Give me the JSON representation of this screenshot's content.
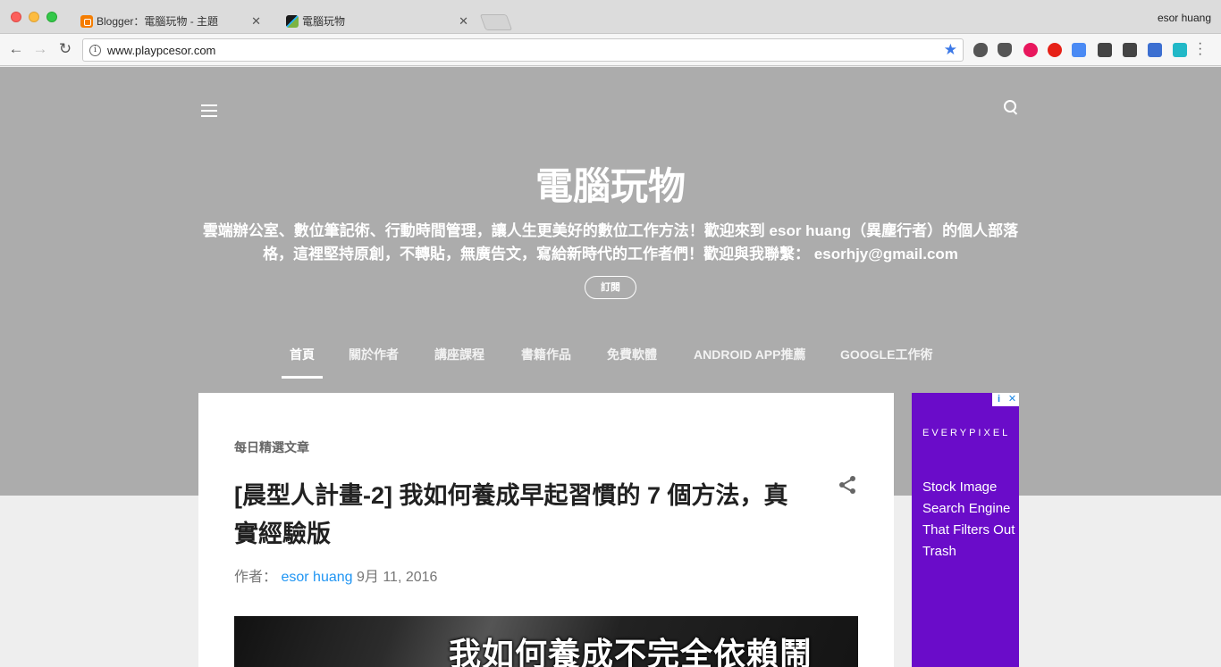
{
  "browser": {
    "tabs": [
      {
        "title": "Blogger：電腦玩物 - 主題",
        "close": "✕"
      },
      {
        "title": "電腦玩物",
        "close": "✕"
      }
    ],
    "profile": "esor huang",
    "url": "www.playpcesor.com",
    "info_glyph": "i",
    "star_glyph": "★",
    "back_glyph": "←",
    "forward_glyph": "→",
    "reload_glyph": "↻"
  },
  "blog": {
    "title": "電腦玩物",
    "description": "雲端辦公室、數位筆記術、行動時間管理，讓人生更美好的數位工作方法！歡迎來到 esor huang（異塵行者）的個人部落格，這裡堅持原創，不轉貼，無廣告文，寫給新時代的工作者們！歡迎與我聯繫： esorhjy@gmail.com",
    "subscribe_label": "訂閱"
  },
  "nav": {
    "items": [
      {
        "label": "首頁"
      },
      {
        "label": "關於作者"
      },
      {
        "label": "講座課程"
      },
      {
        "label": "書籍作品"
      },
      {
        "label": "免費軟體"
      },
      {
        "label": "ANDROID APP推薦"
      },
      {
        "label": "GOOGLE工作術"
      }
    ]
  },
  "post": {
    "label": "每日精選文章",
    "title": "[晨型人計畫-2] 我如何養成早起習慣的 7 個方法，真實經驗版",
    "author_prefix": "作者：",
    "author": "esor huang",
    "date": "9月 11, 2016",
    "image_caption": "我如何養成不完全依賴鬧"
  },
  "ad": {
    "badge_info": "i",
    "badge_close": "✕",
    "brand": "EVERYPIXEL",
    "text": "Stock Image Search Engine That Filters Out Trash",
    "bg_color": "#6a0cc9"
  }
}
